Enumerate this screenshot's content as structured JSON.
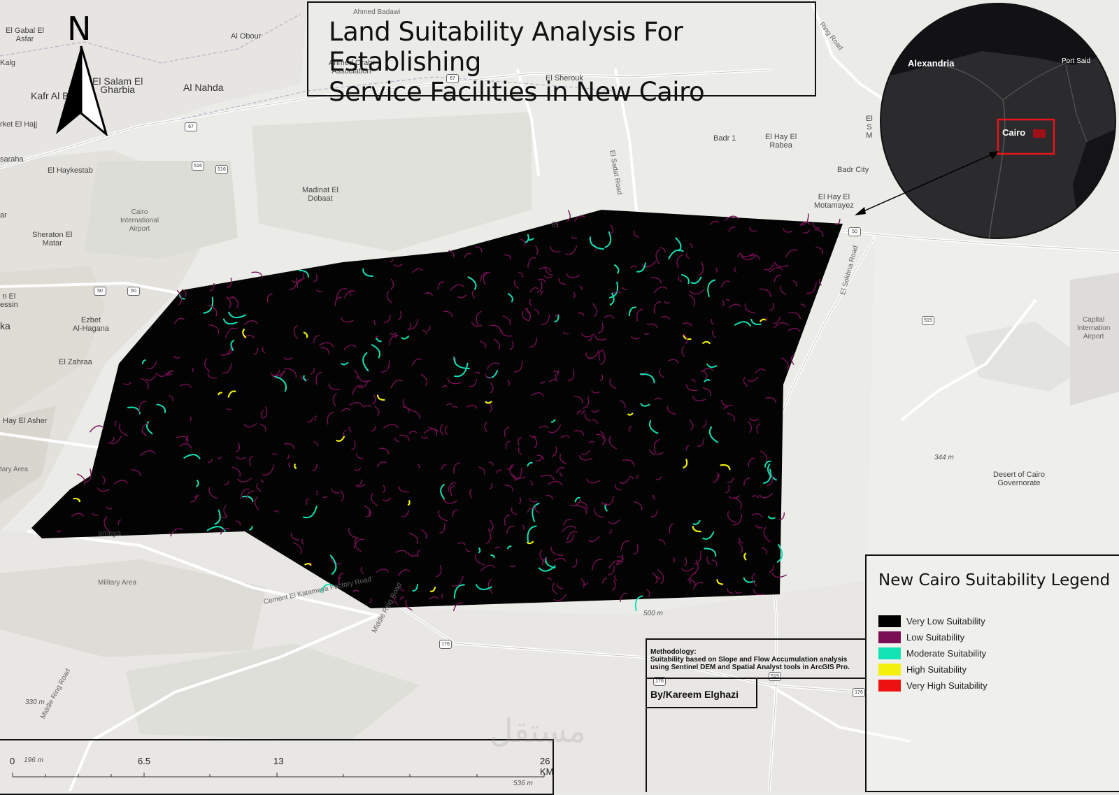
{
  "title": {
    "line1": "Land Suitability Analysis For Establishing",
    "line2": "Service Facilities in New Cairo"
  },
  "north_arrow": {
    "label": "N"
  },
  "base_map_labels": [
    {
      "text": "El Gabal El\nAsfar",
      "kind": "place"
    },
    {
      "text": "Al Obour",
      "kind": "place"
    },
    {
      "text": "Kalg",
      "kind": "place"
    },
    {
      "text": "El Salam El\nGharbia",
      "kind": "big"
    },
    {
      "text": "Al Nahda",
      "kind": "big"
    },
    {
      "text": "Kafr Al Basha",
      "kind": "big"
    },
    {
      "text": "rket El Hajj",
      "kind": "place"
    },
    {
      "text": "Ahmed Orabi\nAssociation",
      "kind": "place"
    },
    {
      "text": "El Sherouk",
      "kind": "place"
    },
    {
      "text": "Ahmed Badawi",
      "kind": "road"
    },
    {
      "text": "El Haykestab",
      "kind": "place"
    },
    {
      "text": "saraha",
      "kind": "place"
    },
    {
      "text": "Madinat El\nDobaat",
      "kind": "place"
    },
    {
      "text": "Badr 1",
      "kind": "place"
    },
    {
      "text": "El Hay El\nRabea",
      "kind": "place"
    },
    {
      "text": "Badr City",
      "kind": "place"
    },
    {
      "text": "El Hay El\nMotamayez",
      "kind": "place"
    },
    {
      "text": "El\nS\nM",
      "kind": "place"
    },
    {
      "text": "Cairo\nInternational\nAirport",
      "kind": "road"
    },
    {
      "text": "Sheraton El\nMatar",
      "kind": "place"
    },
    {
      "text": "ar",
      "kind": "place"
    },
    {
      "text": "n El\nessin",
      "kind": "place"
    },
    {
      "text": "ka",
      "kind": "big"
    },
    {
      "text": "Ezbet\nAl-Hagana",
      "kind": "place"
    },
    {
      "text": "El Zahraa",
      "kind": "place"
    },
    {
      "text": "Hay El Asher",
      "kind": "place"
    },
    {
      "text": "tary Area",
      "kind": "road"
    },
    {
      "text": "Military Area",
      "kind": "road"
    },
    {
      "text": "El Sadat Road",
      "kind": "road"
    },
    {
      "text": "El Sokhna Road",
      "kind": "road"
    },
    {
      "text": "Cement El Katameya Factory Road",
      "kind": "road"
    },
    {
      "text": "Middle Ring Road",
      "kind": "road"
    },
    {
      "text": "Middle Ring Road",
      "kind": "road"
    },
    {
      "text": "Ring Road",
      "kind": "road"
    },
    {
      "text": "Capital\nInternation\nAirport",
      "kind": "road"
    },
    {
      "text": "Desert of Cairo\nGovernorate",
      "kind": "place"
    },
    {
      "text": "344 m",
      "kind": "elev"
    },
    {
      "text": "500 m",
      "kind": "elev"
    },
    {
      "text": "330 m",
      "kind": "elev"
    },
    {
      "text": "196 m",
      "kind": "elev"
    },
    {
      "text": "536 m",
      "kind": "elev"
    },
    {
      "text": "El",
      "kind": "place"
    },
    {
      "text": "ameya",
      "kind": "place"
    }
  ],
  "road_shields": [
    "67",
    "67",
    "516",
    "516",
    "50",
    "50",
    "50",
    "515",
    "176",
    "176",
    "515",
    "176"
  ],
  "inset_map": {
    "labels": [
      "Alexandria",
      "Port Said",
      "Cairo"
    ],
    "colors": {
      "land": "#2b2b2d",
      "water": "#121214",
      "highlight": "#e8141b"
    }
  },
  "legend": {
    "title": "New Cairo Suitability Legend",
    "items": [
      {
        "label": "Very Low Suitability",
        "color": "#000000"
      },
      {
        "label": "Low Suitability",
        "color": "#7a0f55"
      },
      {
        "label": "Moderate Suitability",
        "color": "#12e3b5"
      },
      {
        "label": "High Suitability",
        "color": "#f4f00e"
      },
      {
        "label": "Very High Suitability",
        "color": "#ee1111"
      }
    ]
  },
  "methodology": {
    "heading": "Methodology:",
    "line1": "Suitability based on Slope and Flow Accumulation analysis",
    "line2": "using Sentinel DEM and Spatial Analyst tools in ArcGIS Pro."
  },
  "author": "By/Kareem Elghazi",
  "scale_bar": {
    "labels": [
      "0",
      "6.5",
      "13",
      "26 KM"
    ]
  },
  "watermark": "مستقل"
}
